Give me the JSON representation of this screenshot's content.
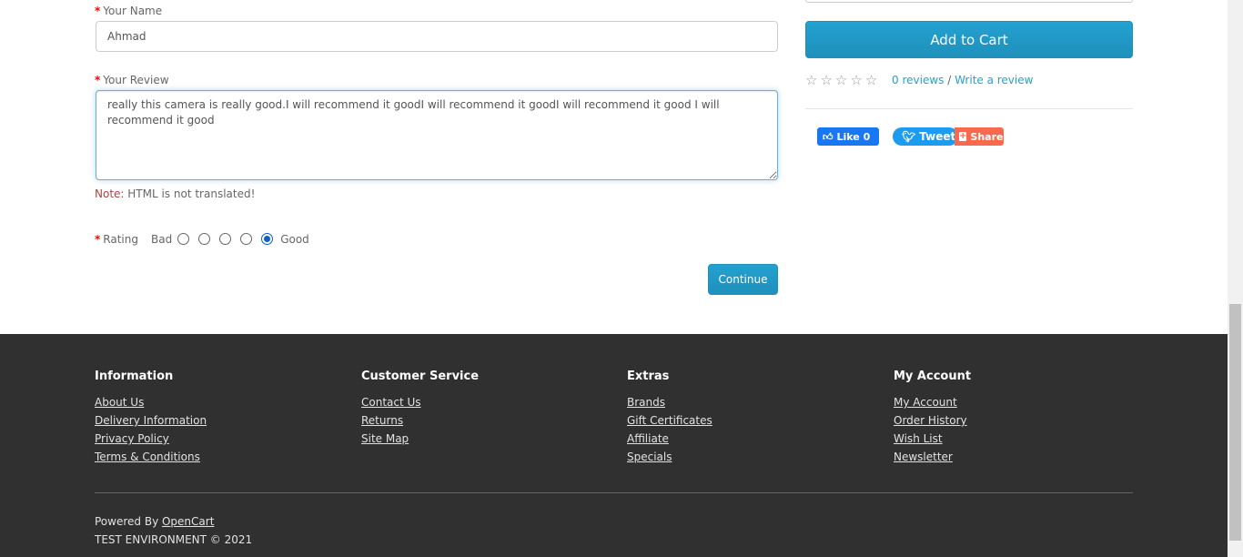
{
  "review_form": {
    "name_label": "Your Name",
    "name_value": "Ahmad",
    "review_label": "Your Review",
    "review_value": "really this camera is really good.I will recommend it goodI will recommend it goodI will recommend it good I will recommend it good",
    "note_label": "Note:",
    "note_text": " HTML is not translated!",
    "rating_label": "Rating",
    "rating_bad": "Bad",
    "rating_good": "Good",
    "rating_selected": 5,
    "continue_label": "Continue"
  },
  "product": {
    "add_to_cart_label": "Add to Cart",
    "reviews_link": "0 reviews",
    "separator": "/",
    "write_review_link": "Write a review",
    "stars_filled": 0,
    "stars_total": 5
  },
  "social": {
    "fb_label": "Like 0",
    "tweet_label": "Tweet",
    "share_label": "Share"
  },
  "footer": {
    "columns": [
      {
        "title": "Information",
        "links": [
          "About Us",
          "Delivery Information",
          "Privacy Policy",
          "Terms & Conditions"
        ]
      },
      {
        "title": "Customer Service",
        "links": [
          "Contact Us",
          "Returns",
          "Site Map"
        ]
      },
      {
        "title": "Extras",
        "links": [
          "Brands",
          "Gift Certificates",
          "Affiliate",
          "Specials"
        ]
      },
      {
        "title": "My Account",
        "links": [
          "My Account",
          "Order History",
          "Wish List",
          "Newsletter"
        ]
      }
    ],
    "powered_prefix": "Powered By ",
    "powered_link": "OpenCart",
    "copyright": "TEST ENVIRONMENT © 2021"
  },
  "colors": {
    "accent": "#23a1d1",
    "footer_bg": "#303030",
    "required": "#ff0000"
  }
}
